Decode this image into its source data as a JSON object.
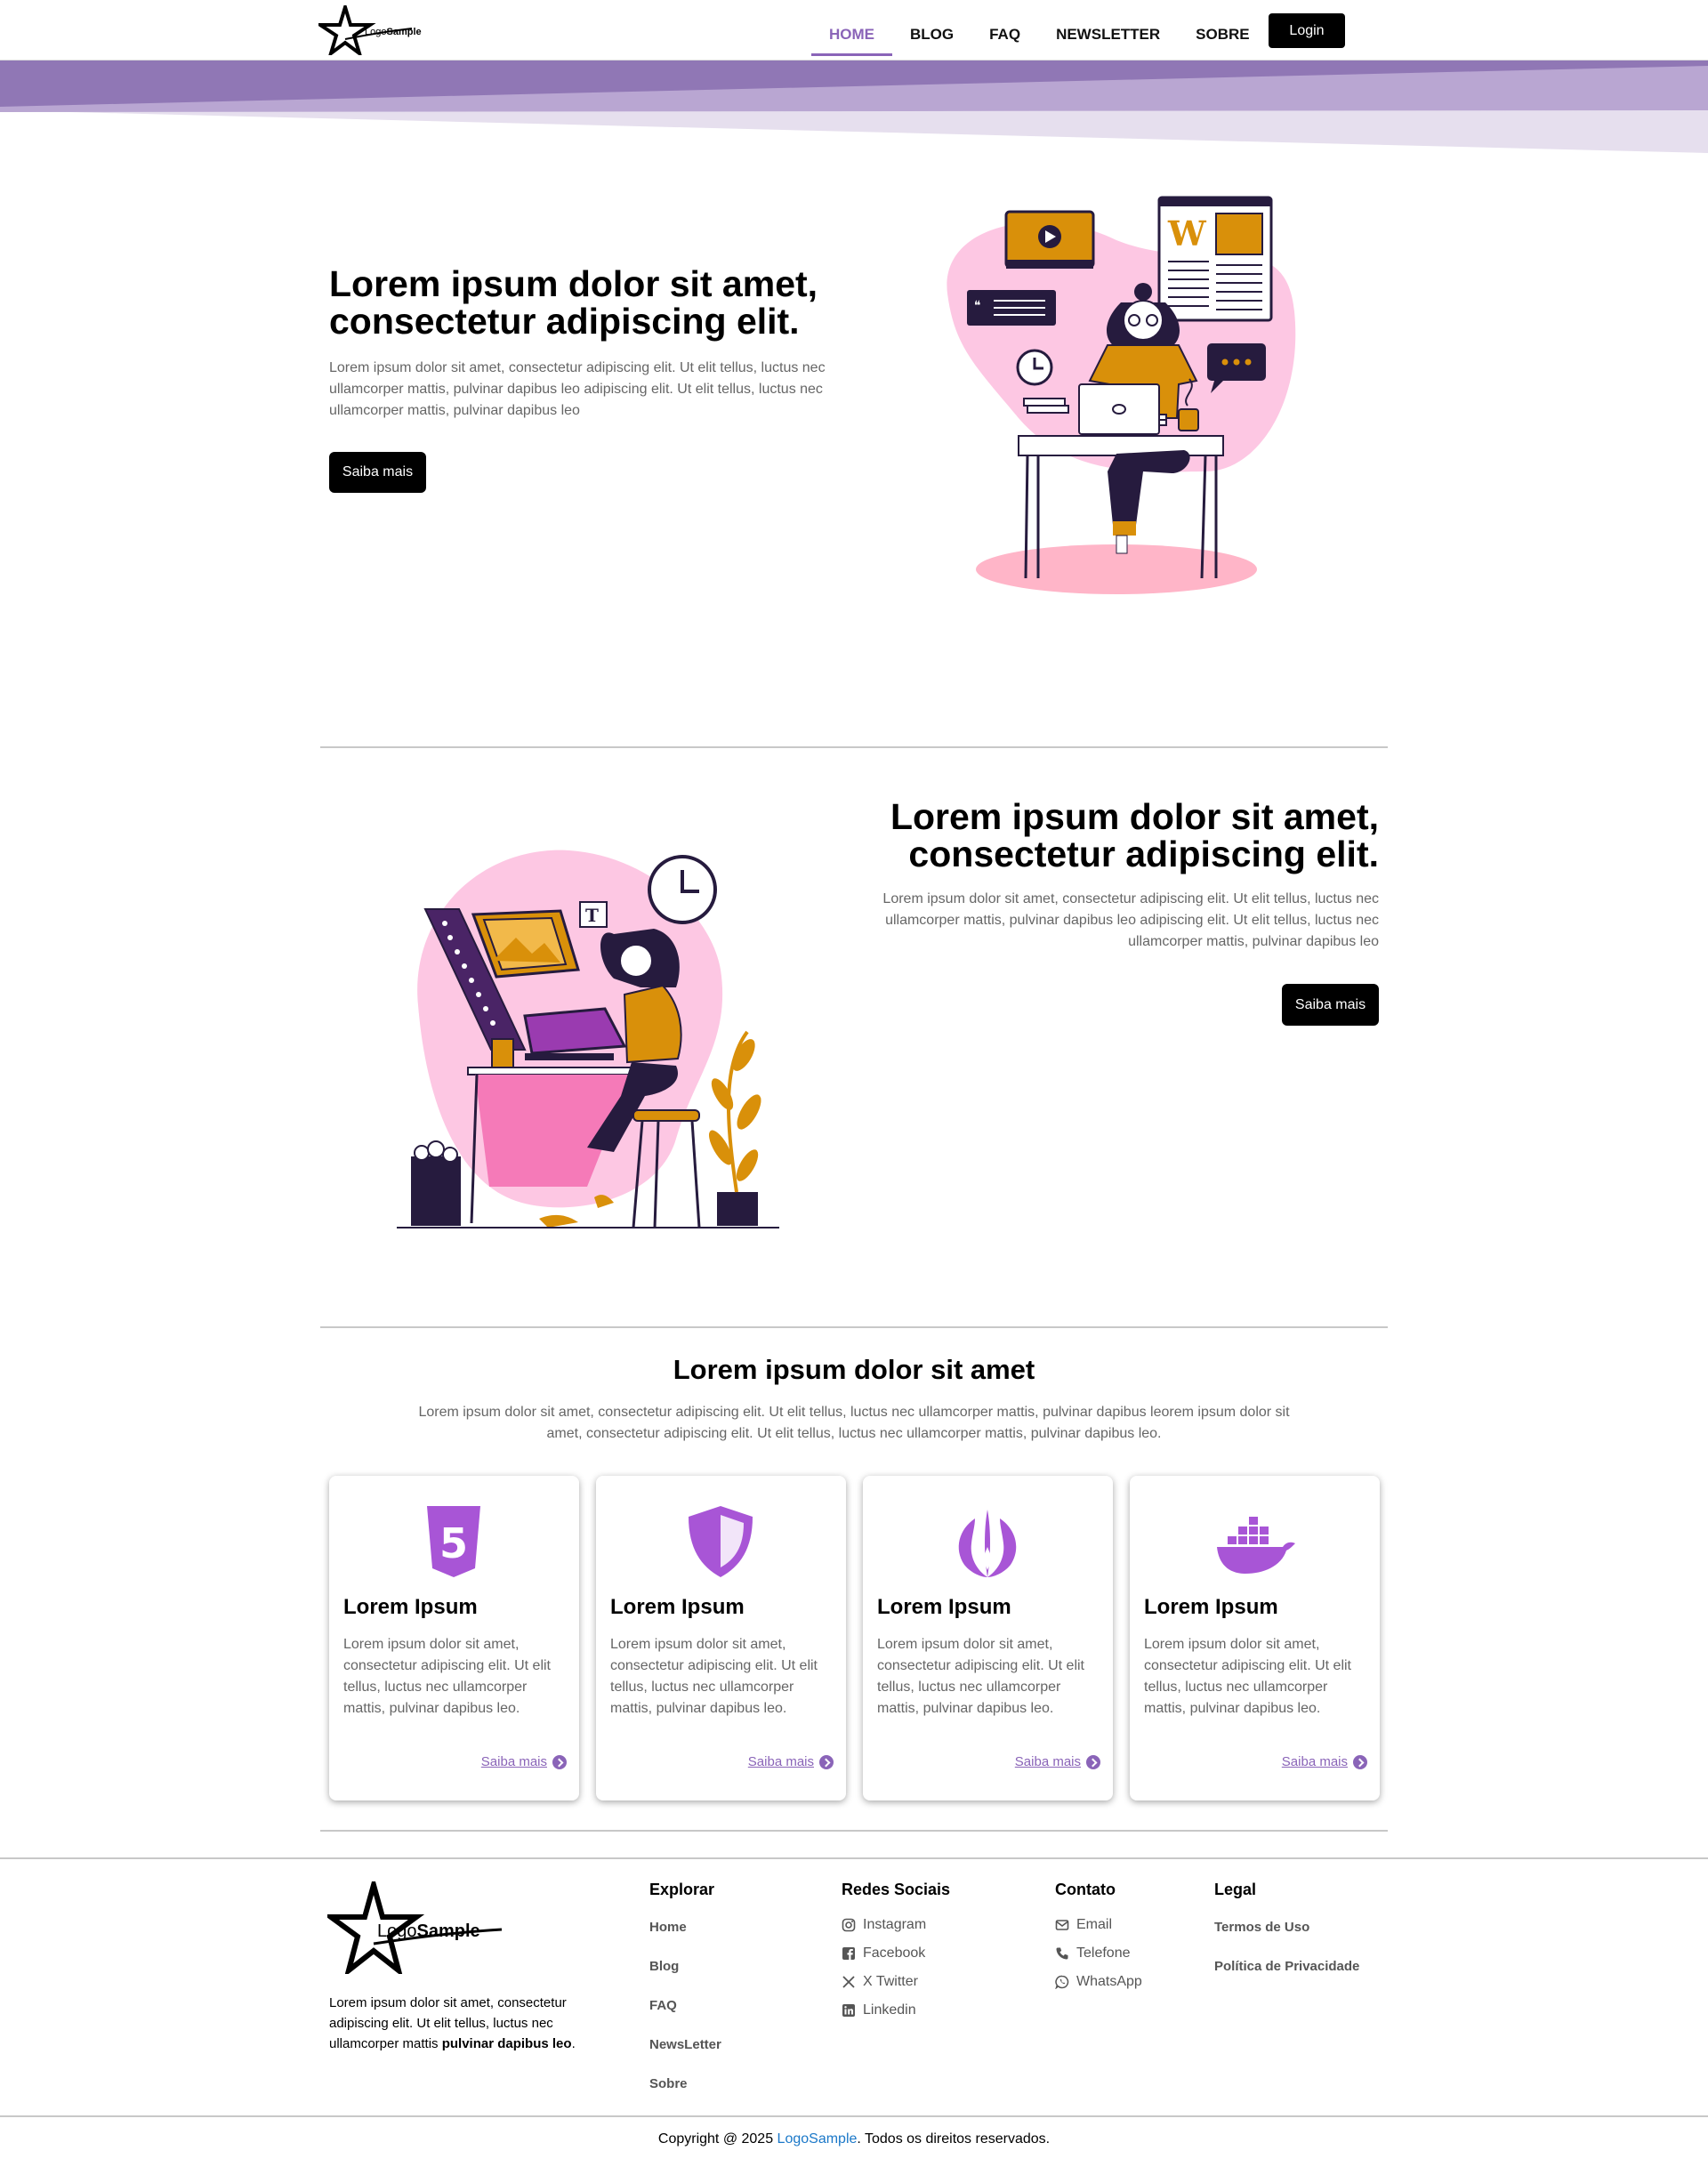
{
  "navbar": {
    "logo_text_pre": "Logo",
    "logo_text_bold": "Sample",
    "links": [
      "HOME",
      "BLOG",
      "FAQ",
      "NEWSLETTER",
      "SOBRE"
    ],
    "login_label": "Login"
  },
  "hero1": {
    "title_line1": "Lorem ipsum dolor sit amet,",
    "title_line2": "consectetur adipiscing elit.",
    "text": "Lorem ipsum dolor sit amet, consectetur adipiscing elit. Ut elit tellus, luctus nec ullamcorper mattis, pulvinar dapibus leo adipiscing elit. Ut elit tellus, luctus nec ullamcorper mattis, pulvinar dapibus leo",
    "button_label": "Saiba mais"
  },
  "hero2": {
    "title_line1": "Lorem ipsum dolor sit amet,",
    "title_line2": "consectetur adipiscing elit.",
    "text": "Lorem ipsum dolor sit amet, consectetur adipiscing elit. Ut elit tellus, luctus nec ullamcorper mattis, pulvinar dapibus leo adipiscing elit. Ut elit tellus, luctus nec ullamcorper mattis, pulvinar dapibus leo",
    "button_label": "Saiba mais"
  },
  "features": {
    "title": "Lorem ipsum dolor sit amet",
    "text": "Lorem ipsum dolor sit amet, consectetur adipiscing elit. Ut elit tellus, luctus nec ullamcorper mattis, pulvinar dapibus leorem ipsum dolor sit amet, consectetur adipiscing elit. Ut elit tellus, luctus nec ullamcorper mattis, pulvinar dapibus leo.",
    "cards": [
      {
        "icon": "html5-icon",
        "title": "Lorem Ipsum",
        "text": "Lorem ipsum dolor sit amet, consectetur adipiscing elit. Ut elit tellus, luctus nec ullamcorper mattis, pulvinar dapibus leo.",
        "link": "Saiba mais"
      },
      {
        "icon": "shield-icon",
        "title": "Lorem Ipsum",
        "text": "Lorem ipsum dolor sit amet, consectetur adipiscing elit. Ut elit tellus, luctus nec ullamcorper mattis, pulvinar dapibus leo.",
        "link": "Saiba mais"
      },
      {
        "icon": "jedi-order-icon",
        "title": "Lorem Ipsum",
        "text": "Lorem ipsum dolor sit amet, consectetur adipiscing elit. Ut elit tellus, luctus nec ullamcorper mattis, pulvinar dapibus leo.",
        "link": "Saiba mais"
      },
      {
        "icon": "docker-icon",
        "title": "Lorem Ipsum",
        "text": "Lorem ipsum dolor sit amet, consectetur adipiscing elit. Ut elit tellus, luctus nec ullamcorper mattis, pulvinar dapibus leo.",
        "link": "Saiba mais"
      }
    ]
  },
  "footer": {
    "desc_plain": "Lorem ipsum dolor sit amet, consectetur adipiscing elit. Ut elit tellus, luctus nec ullamcorper mattis ",
    "desc_bold": "pulvinar dapibus leo",
    "desc_end": ".",
    "explorar": {
      "heading": "Explorar",
      "links": [
        "Home",
        "Blog",
        "FAQ",
        "NewsLetter",
        "Sobre"
      ]
    },
    "redes": {
      "heading": "Redes Sociais",
      "links": [
        "Instagram",
        "Facebook",
        "X Twitter",
        "Linkedin"
      ]
    },
    "contato": {
      "heading": "Contato",
      "links": [
        "Email",
        "Telefone",
        "WhatsApp"
      ]
    },
    "legal": {
      "heading": "Legal",
      "links": [
        "Termos de Uso",
        "Política de Privacidade"
      ]
    },
    "copyright_pre": "Copyright @ 2025 ",
    "copyright_brand": "LogoSample",
    "copyright_post": ". Todos os direitos reservados."
  },
  "colors": {
    "accent": "#8a64b8",
    "icon_purple": "#a855d6",
    "illustration_pink": "#fdc7e3",
    "illustration_orange": "#d9900a",
    "illustration_navy": "#261b3e",
    "link_blue": "#1b78c8"
  }
}
